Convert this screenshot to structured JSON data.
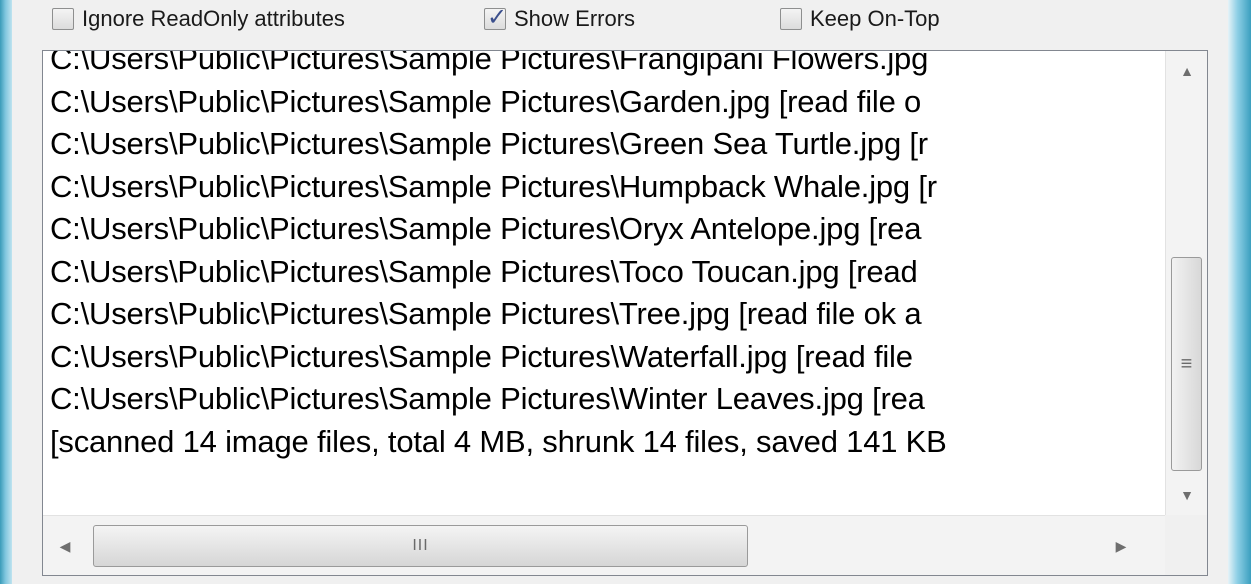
{
  "options": {
    "ignore_readonly": {
      "label": "Ignore ReadOnly attributes",
      "checked": false
    },
    "show_errors": {
      "label": "Show Errors",
      "checked": true
    },
    "keep_on_top": {
      "label": "Keep On-Top",
      "checked": false
    },
    "check_mark": "✓"
  },
  "log": {
    "lines": [
      "C:\\Users\\Public\\Pictures\\Sample Pictures\\Frangipani Flowers.jpg",
      "C:\\Users\\Public\\Pictures\\Sample Pictures\\Garden.jpg [read file o",
      "C:\\Users\\Public\\Pictures\\Sample Pictures\\Green Sea Turtle.jpg [r",
      "C:\\Users\\Public\\Pictures\\Sample Pictures\\Humpback Whale.jpg [r",
      "C:\\Users\\Public\\Pictures\\Sample Pictures\\Oryx Antelope.jpg [rea",
      "C:\\Users\\Public\\Pictures\\Sample Pictures\\Toco Toucan.jpg [read",
      "C:\\Users\\Public\\Pictures\\Sample Pictures\\Tree.jpg [read file ok a",
      "C:\\Users\\Public\\Pictures\\Sample Pictures\\Waterfall.jpg [read file",
      "C:\\Users\\Public\\Pictures\\Sample Pictures\\Winter Leaves.jpg [rea",
      "[scanned 14 image files, total 4 MB, shrunk 14 files, saved 141 KB"
    ]
  },
  "scrollbars": {
    "up_arrow": "▲",
    "down_arrow": "▼",
    "left_arrow": "◀",
    "right_arrow": "▶",
    "vertical_grip": "≡",
    "horizontal_grip": "III"
  }
}
